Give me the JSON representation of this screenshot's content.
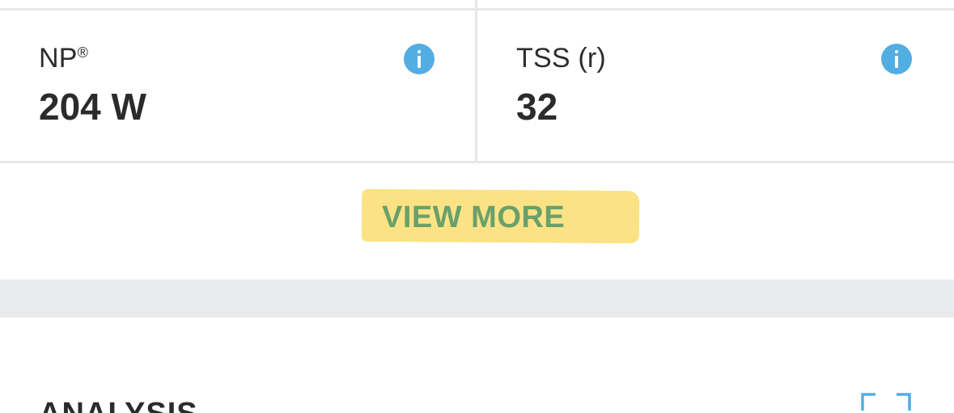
{
  "metrics": [
    {
      "label": "NP",
      "label_mark": "®",
      "value": "204 W",
      "icon": "info-icon"
    },
    {
      "label": "TSS (r)",
      "label_mark": "",
      "value": "32",
      "icon": "info-icon"
    }
  ],
  "view_more": {
    "label": "VIEW MORE",
    "highlight_color": "#fbe27e",
    "text_color": "#6aa06a"
  },
  "analysis": {
    "title": "ANALYSIS",
    "expand_icon": "expand-icon"
  },
  "colors": {
    "info_icon": "#52ade3",
    "divider": "#e6e7e9",
    "band": "#e9eaec"
  }
}
